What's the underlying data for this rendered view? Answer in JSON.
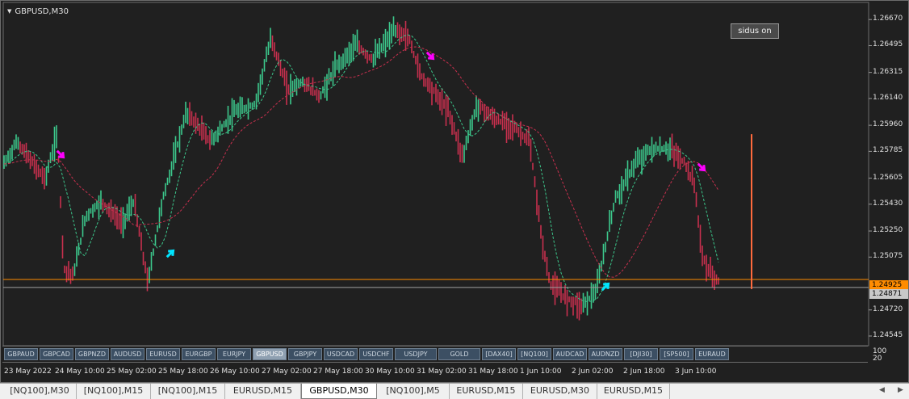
{
  "chart": {
    "title": "GBPUSD,M30",
    "indicator_button": "sidus on",
    "price_axis": [
      "1.26670",
      "1.26495",
      "1.26315",
      "1.26140",
      "1.25960",
      "1.25785",
      "1.25605",
      "1.25430",
      "1.25250",
      "1.25075",
      "1.24720",
      "1.24545"
    ],
    "bid_price": "1.24925",
    "crosshair_price": "1.24871",
    "indicator_window_levels": [
      "100",
      "20"
    ],
    "time_axis": [
      "23 May 2022",
      "24 May 10:00",
      "25 May 02:00",
      "25 May 18:00",
      "26 May 10:00",
      "27 May 02:00",
      "27 May 18:00",
      "30 May 10:00",
      "31 May 02:00",
      "31 May 18:00",
      "1 Jun 10:00",
      "2 Jun 02:00",
      "2 Jun 18:00",
      "3 Jun 10:00"
    ],
    "colors": {
      "background": "#202020",
      "bull_bar": "#3cc88c",
      "bear_bar": "#c8304e",
      "fast_ma": "#3cc88c",
      "slow_ma": "#c8304e",
      "bid_line": "#ff8c00",
      "buy_arrow": "#00e5ff",
      "sell_arrow": "#ff00ff"
    }
  },
  "symbol_buttons": [
    "GBPAUD",
    "GBPCAD",
    "GBPNZD",
    "AUDUSD",
    "EURUSD",
    "EURGBP",
    "EURJPY",
    "GBPUSD",
    "GBPJPY",
    "USDCAD",
    "USDCHF",
    "USDJPY",
    "GOLD",
    "[DAX40]",
    "[NQ100]",
    "AUDCAD",
    "AUDNZD",
    "[DJI30]",
    "[SP500]",
    "EURAUD"
  ],
  "active_symbol": "GBPUSD",
  "tabs": [
    "[NQ100],M30",
    "[NQ100],M15",
    "[NQ100],M15",
    "EURUSD,M15",
    "GBPUSD,M30",
    "[NQ100],M5",
    "EURUSD,M15",
    "EURUSD,M30",
    "EURUSD,M15"
  ],
  "active_tab": "GBPUSD,M30",
  "icons": {
    "left": "arrow-left-icon",
    "right": "arrow-right-icon",
    "menu": "triangle-down-icon"
  }
}
